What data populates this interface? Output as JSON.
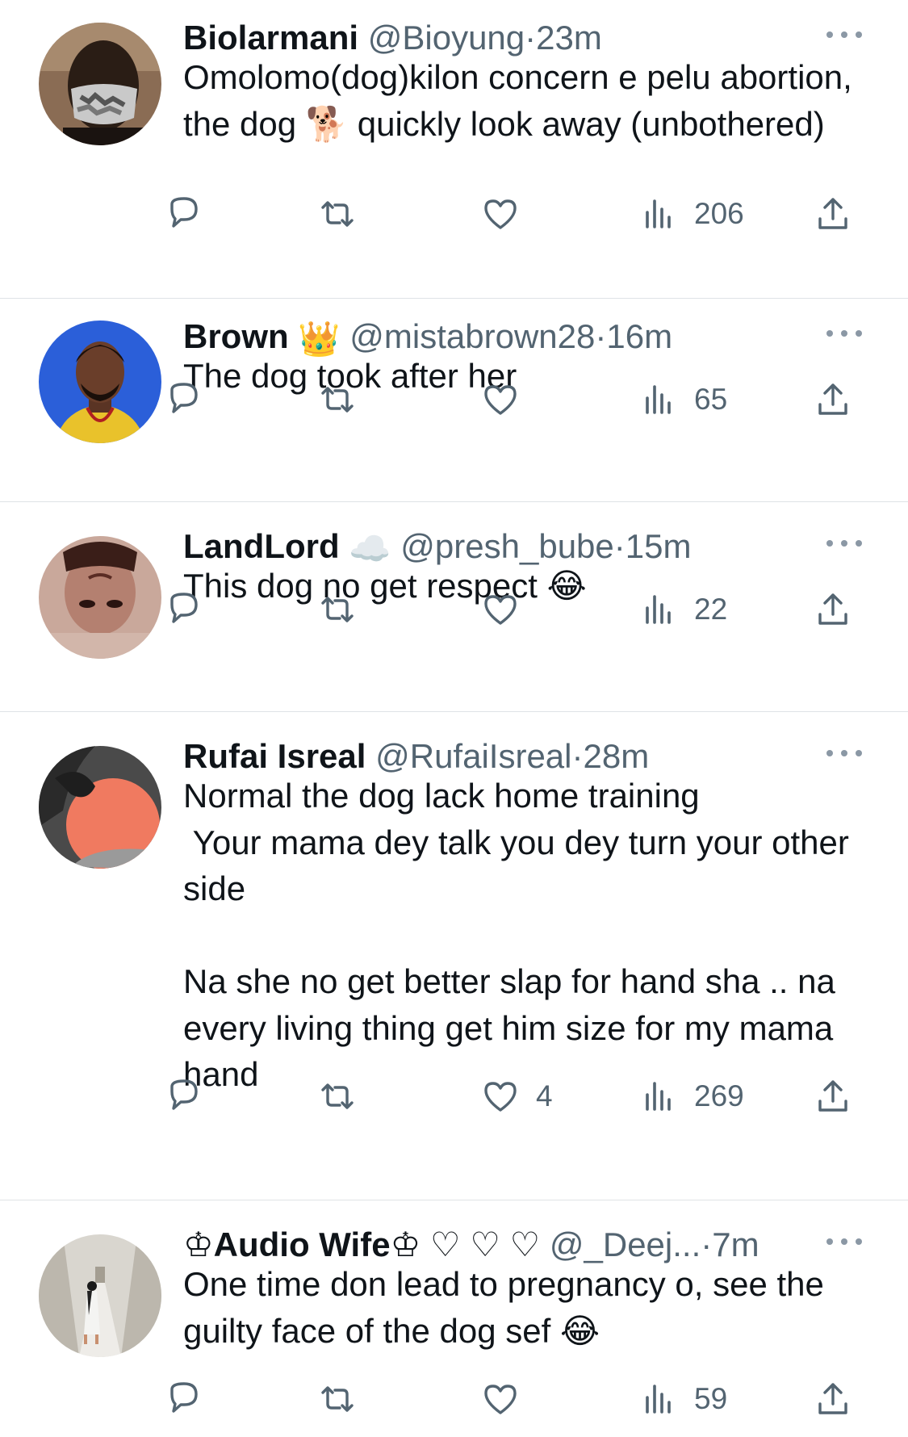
{
  "tweets": [
    {
      "display_name": "Biolarmani",
      "handle": "@Bioyung",
      "separator": "·",
      "time": "23m",
      "text": "Omolomo(dog)kilon concern e pelu abortion, the dog 🐕 quickly look away (unbothered)",
      "avatar_icon": "avatar-masked-man",
      "counts": {
        "reply": "",
        "retweet": "",
        "like": "",
        "views": "206"
      }
    },
    {
      "display_name": "Brown",
      "name_badge": "👑",
      "handle": "@mistabrown28",
      "separator": "·",
      "time": "16m",
      "text": "The dog took after her",
      "avatar_icon": "avatar-man-yellow-shirt",
      "counts": {
        "reply": "",
        "retweet": "",
        "like": "",
        "views": "65"
      }
    },
    {
      "display_name": "LandLord",
      "name_badge": "☁️",
      "handle": "@presh_bube",
      "separator": "·",
      "time": "15m",
      "text": "This dog no get respect 😂",
      "avatar_icon": "avatar-upside-down-face",
      "counts": {
        "reply": "",
        "retweet": "",
        "like": "",
        "views": "22"
      }
    },
    {
      "display_name": "Rufai Isreal",
      "handle": "@RufaiIsreal",
      "separator": "·",
      "time": "28m",
      "text": "Normal the dog lack home training\n Your mama dey talk you dey turn your other side\n\nNa she no get better slap for hand sha .. na every living thing get him size for my mama hand",
      "avatar_icon": "avatar-orange-photo",
      "counts": {
        "reply": "",
        "retweet": "",
        "like": "4",
        "views": "269"
      }
    },
    {
      "display_name": "♔Audio Wife♔ ♡ ♡ ♡",
      "handle": "@_Deej...",
      "separator": "·",
      "time": "7m",
      "text": "One time don lead to pregnancy o, see the guilty face of the dog sef 😂",
      "avatar_icon": "avatar-woman-hallway",
      "counts": {
        "reply": "",
        "retweet": "",
        "like": "",
        "views": "59"
      }
    }
  ],
  "icons": {
    "reply": "reply-icon",
    "retweet": "retweet-icon",
    "like": "heart-icon",
    "views": "views-icon",
    "share": "share-icon",
    "more": "more-icon"
  },
  "colors": {
    "text": "#0f1419",
    "secondary": "#536471",
    "divider": "#dfe3e6"
  }
}
